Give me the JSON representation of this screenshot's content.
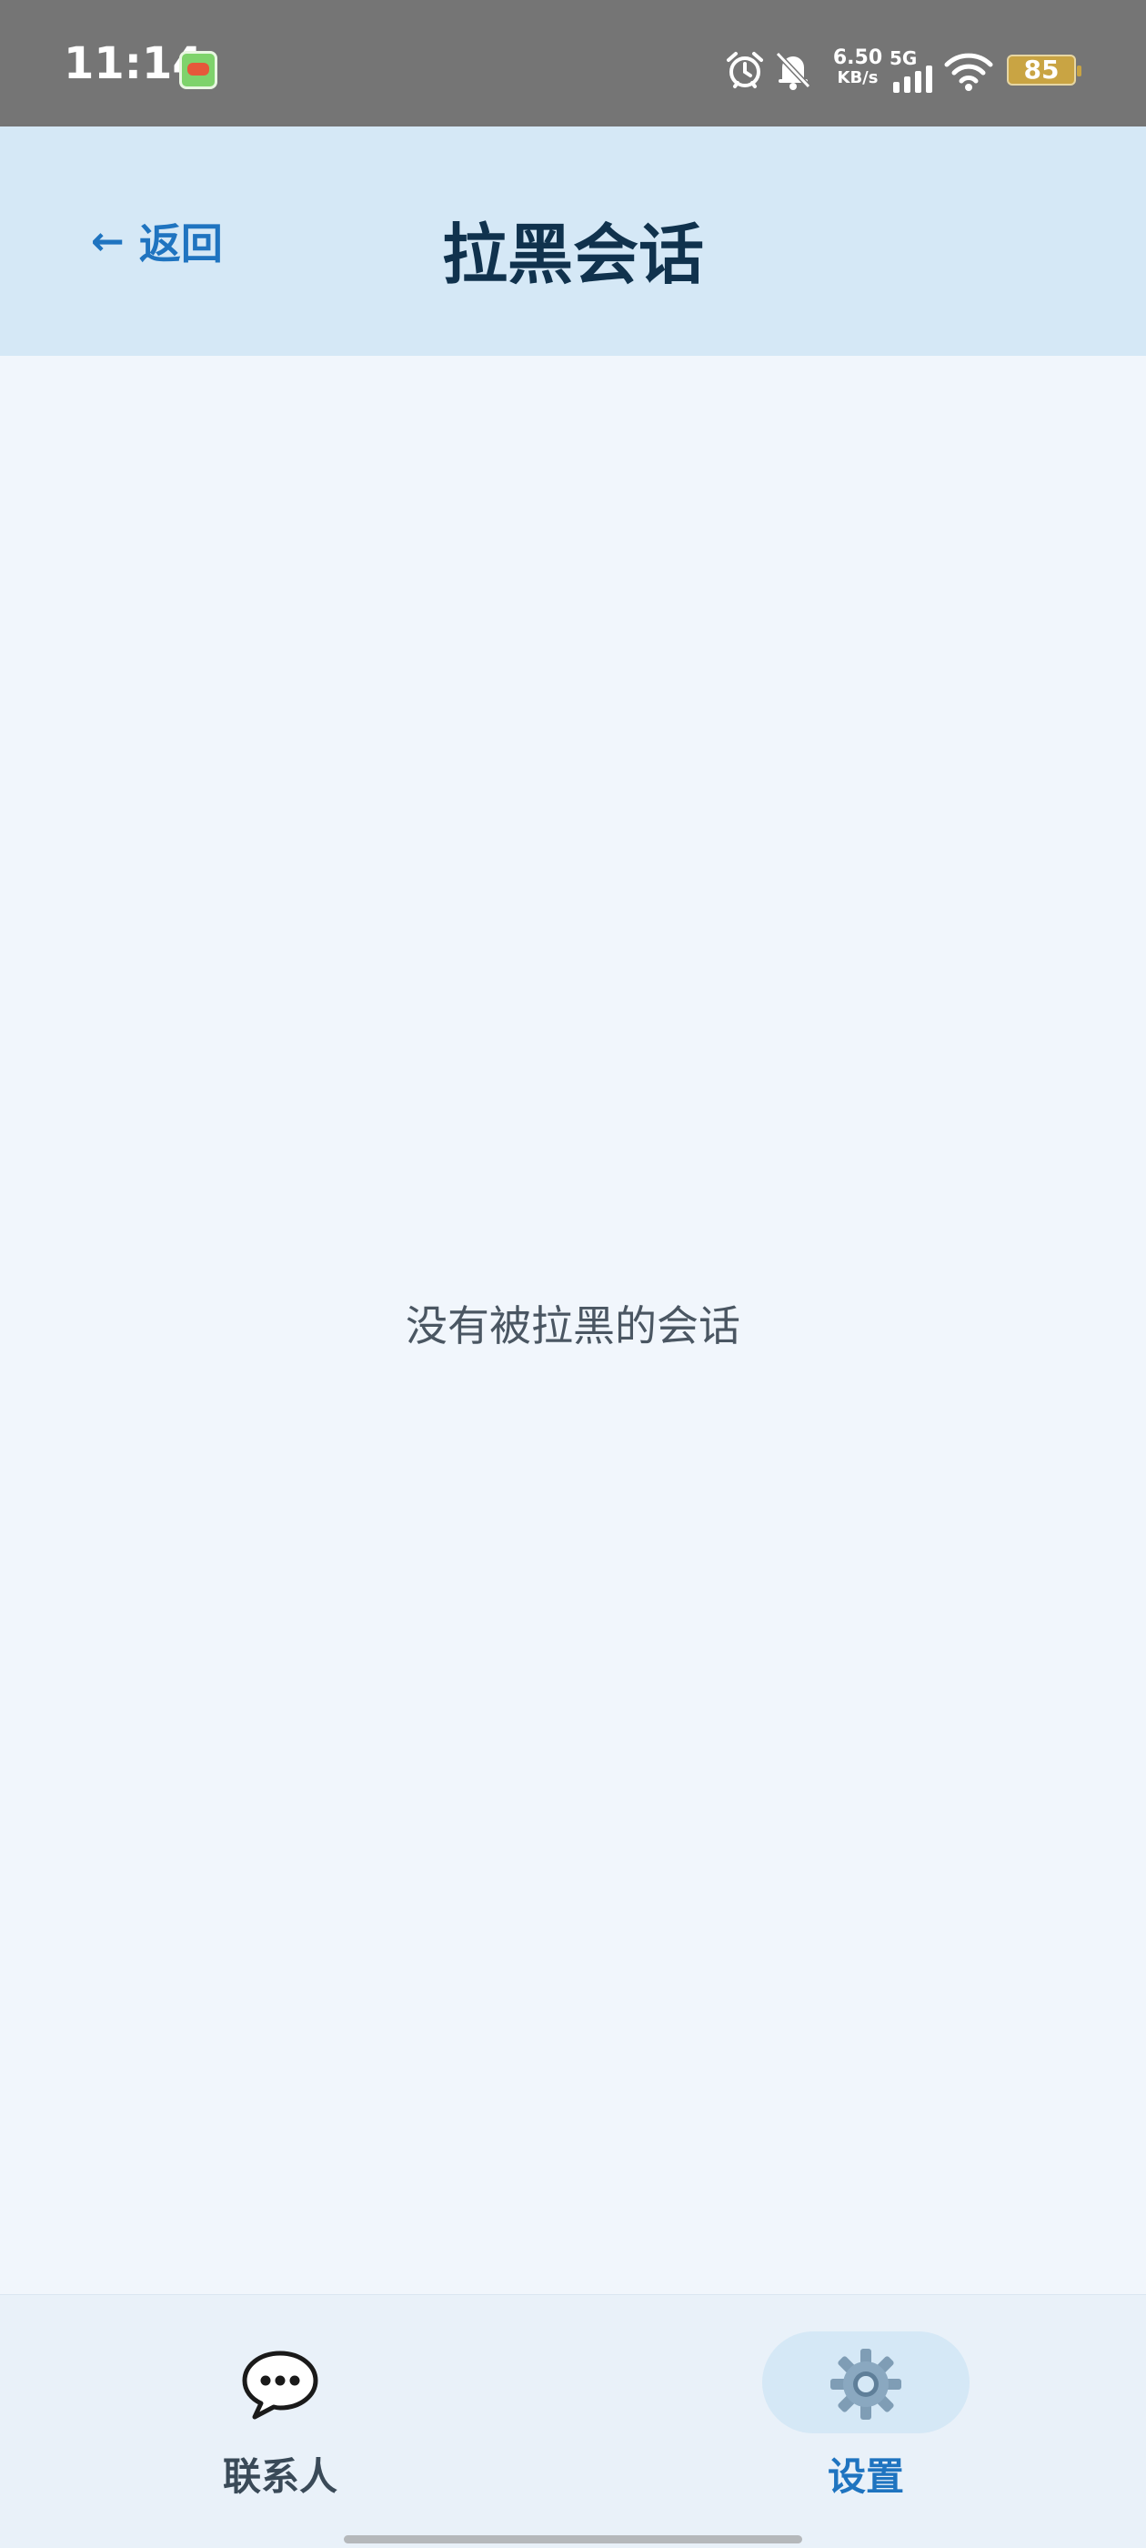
{
  "status_bar": {
    "time": "11:14",
    "net_speed_value": "6.50",
    "net_speed_unit": "KB/s",
    "network_type": "5G",
    "battery": "85",
    "icons": [
      "app-notification-icon",
      "alarm-icon",
      "mute-bell-icon",
      "signal-icon",
      "wifi-icon",
      "battery-icon"
    ]
  },
  "header": {
    "back_arrow": "←",
    "back_label": "返回",
    "title": "拉黑会话"
  },
  "main": {
    "empty_message": "没有被拉黑的会话"
  },
  "bottom_nav": {
    "items": [
      {
        "label": "联系人",
        "icon": "chat-bubble-icon",
        "active": false
      },
      {
        "label": "设置",
        "icon": "gear-icon",
        "active": true
      }
    ]
  },
  "colors": {
    "status_bar_bg": "#757575",
    "header_bg": "#d5e8f6",
    "page_bg": "#f1f6fc",
    "accent": "#1f74c0",
    "title": "#10324d",
    "nav_bg": "#e9f1f9"
  }
}
